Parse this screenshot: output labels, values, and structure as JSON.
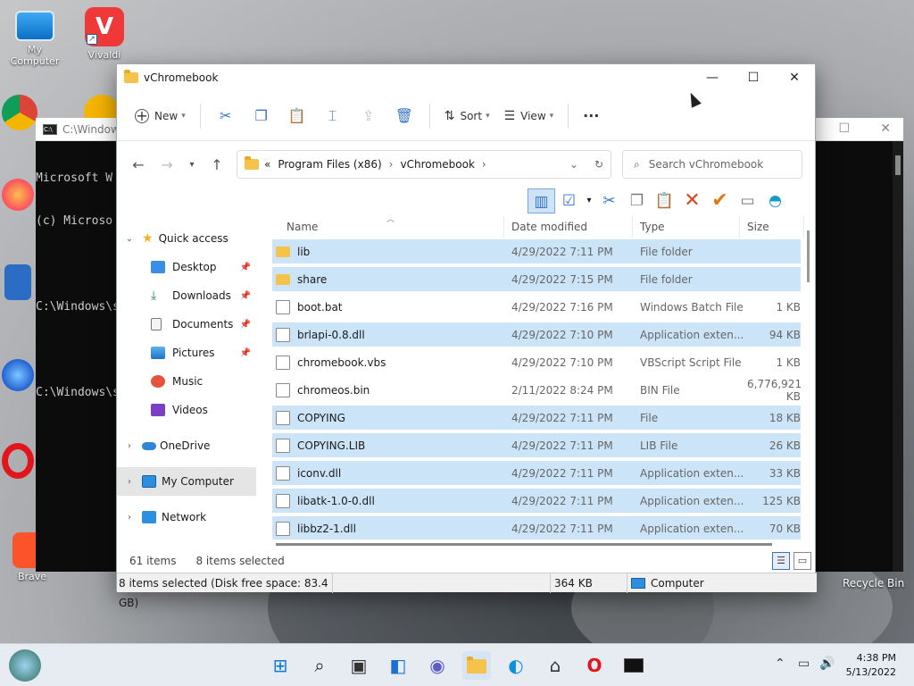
{
  "desktop": {
    "icons": [
      {
        "label": "My Computer"
      },
      {
        "label": "Vivaldi"
      },
      {
        "label": "Goo\nChro"
      },
      {
        "label": "Fire"
      },
      {
        "label": "Calcu"
      },
      {
        "label": "Fire\nDeve"
      },
      {
        "label": "Op\nBrow"
      },
      {
        "label": "Brave"
      }
    ],
    "recycle_bin": "Recycle Bin"
  },
  "cmd": {
    "title": "C:\\Windows\\",
    "lines": [
      "Microsoft W",
      "(c) Microso",
      "",
      "C:\\Windows\\s",
      "",
      "C:\\Windows\\s"
    ]
  },
  "explorer": {
    "title": "vChromebook",
    "toolbar": {
      "new_label": "New",
      "sort_label": "Sort",
      "view_label": "View",
      "more_label": "···"
    },
    "address": {
      "overflow": "«",
      "segments": [
        "Program Files (x86)",
        "vChromebook"
      ]
    },
    "search_placeholder": "Search vChromebook",
    "nav": {
      "quick_access": "Quick access",
      "desktop": "Desktop",
      "downloads": "Downloads",
      "documents": "Documents",
      "pictures": "Pictures",
      "music": "Music",
      "videos": "Videos",
      "onedrive": "OneDrive",
      "my_computer": "My Computer",
      "network": "Network"
    },
    "columns": {
      "name": "Name",
      "date": "Date modified",
      "type": "Type",
      "size": "Size"
    },
    "files": [
      {
        "name": "lib",
        "date": "4/29/2022 7:11 PM",
        "type": "File folder",
        "size": "",
        "selected": true,
        "kind": "folder"
      },
      {
        "name": "share",
        "date": "4/29/2022 7:15 PM",
        "type": "File folder",
        "size": "",
        "selected": true,
        "kind": "folder"
      },
      {
        "name": "boot.bat",
        "date": "4/29/2022 7:16 PM",
        "type": "Windows Batch File",
        "size": "1 KB",
        "selected": false,
        "kind": "file"
      },
      {
        "name": "brlapi-0.8.dll",
        "date": "4/29/2022 7:10 PM",
        "type": "Application exten...",
        "size": "94 KB",
        "selected": true,
        "kind": "file"
      },
      {
        "name": "chromebook.vbs",
        "date": "4/29/2022 7:10 PM",
        "type": "VBScript Script File",
        "size": "1 KB",
        "selected": false,
        "kind": "file"
      },
      {
        "name": "chromeos.bin",
        "date": "2/11/2022 8:24 PM",
        "type": "BIN File",
        "size": "6,776,921 KB",
        "selected": false,
        "kind": "file"
      },
      {
        "name": "COPYING",
        "date": "4/29/2022 7:11 PM",
        "type": "File",
        "size": "18 KB",
        "selected": true,
        "kind": "file"
      },
      {
        "name": "COPYING.LIB",
        "date": "4/29/2022 7:11 PM",
        "type": "LIB File",
        "size": "26 KB",
        "selected": true,
        "kind": "file"
      },
      {
        "name": "iconv.dll",
        "date": "4/29/2022 7:11 PM",
        "type": "Application exten...",
        "size": "33 KB",
        "selected": true,
        "kind": "file"
      },
      {
        "name": "libatk-1.0-0.dll",
        "date": "4/29/2022 7:11 PM",
        "type": "Application exten...",
        "size": "125 KB",
        "selected": true,
        "kind": "file"
      },
      {
        "name": "libbz2-1.dll",
        "date": "4/29/2022 7:11 PM",
        "type": "Application exten...",
        "size": "70 KB",
        "selected": true,
        "kind": "file"
      }
    ],
    "status": {
      "items": "61 items",
      "selected": "8 items selected"
    },
    "legacy_status": {
      "info": "8 items selected (Disk free space: 83.4 GB)",
      "size": "364 KB",
      "location": "Computer"
    }
  },
  "taskbar": {
    "time": "4:38 PM",
    "date": "5/13/2022"
  },
  "colors": {
    "accent": "#3773c6",
    "selection": "#cce4f7"
  }
}
